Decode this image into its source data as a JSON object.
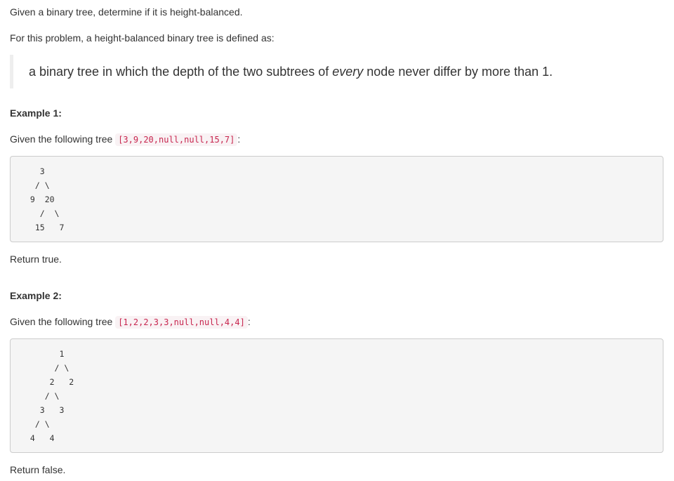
{
  "intro": {
    "line1": "Given a binary tree, determine if it is height-balanced.",
    "line2": "For this problem, a height-balanced binary tree is defined as:"
  },
  "definition": {
    "before": "a binary tree in which the depth of the two subtrees of ",
    "emphasis": "every",
    "after": " node never differ by more than 1."
  },
  "example1": {
    "heading": "Example 1:",
    "given_prefix": "Given the following tree ",
    "given_code": "[3,9,20,null,null,15,7]",
    "given_suffix": ":",
    "tree": "   3\n  / \\\n 9  20\n   /  \\\n  15   7",
    "result": "Return true."
  },
  "example2": {
    "heading": "Example 2:",
    "given_prefix": "Given the following tree ",
    "given_code": "[1,2,2,3,3,null,null,4,4]",
    "given_suffix": ":",
    "tree": "       1\n      / \\\n     2   2\n    / \\\n   3   3\n  / \\\n 4   4",
    "result": "Return false."
  }
}
